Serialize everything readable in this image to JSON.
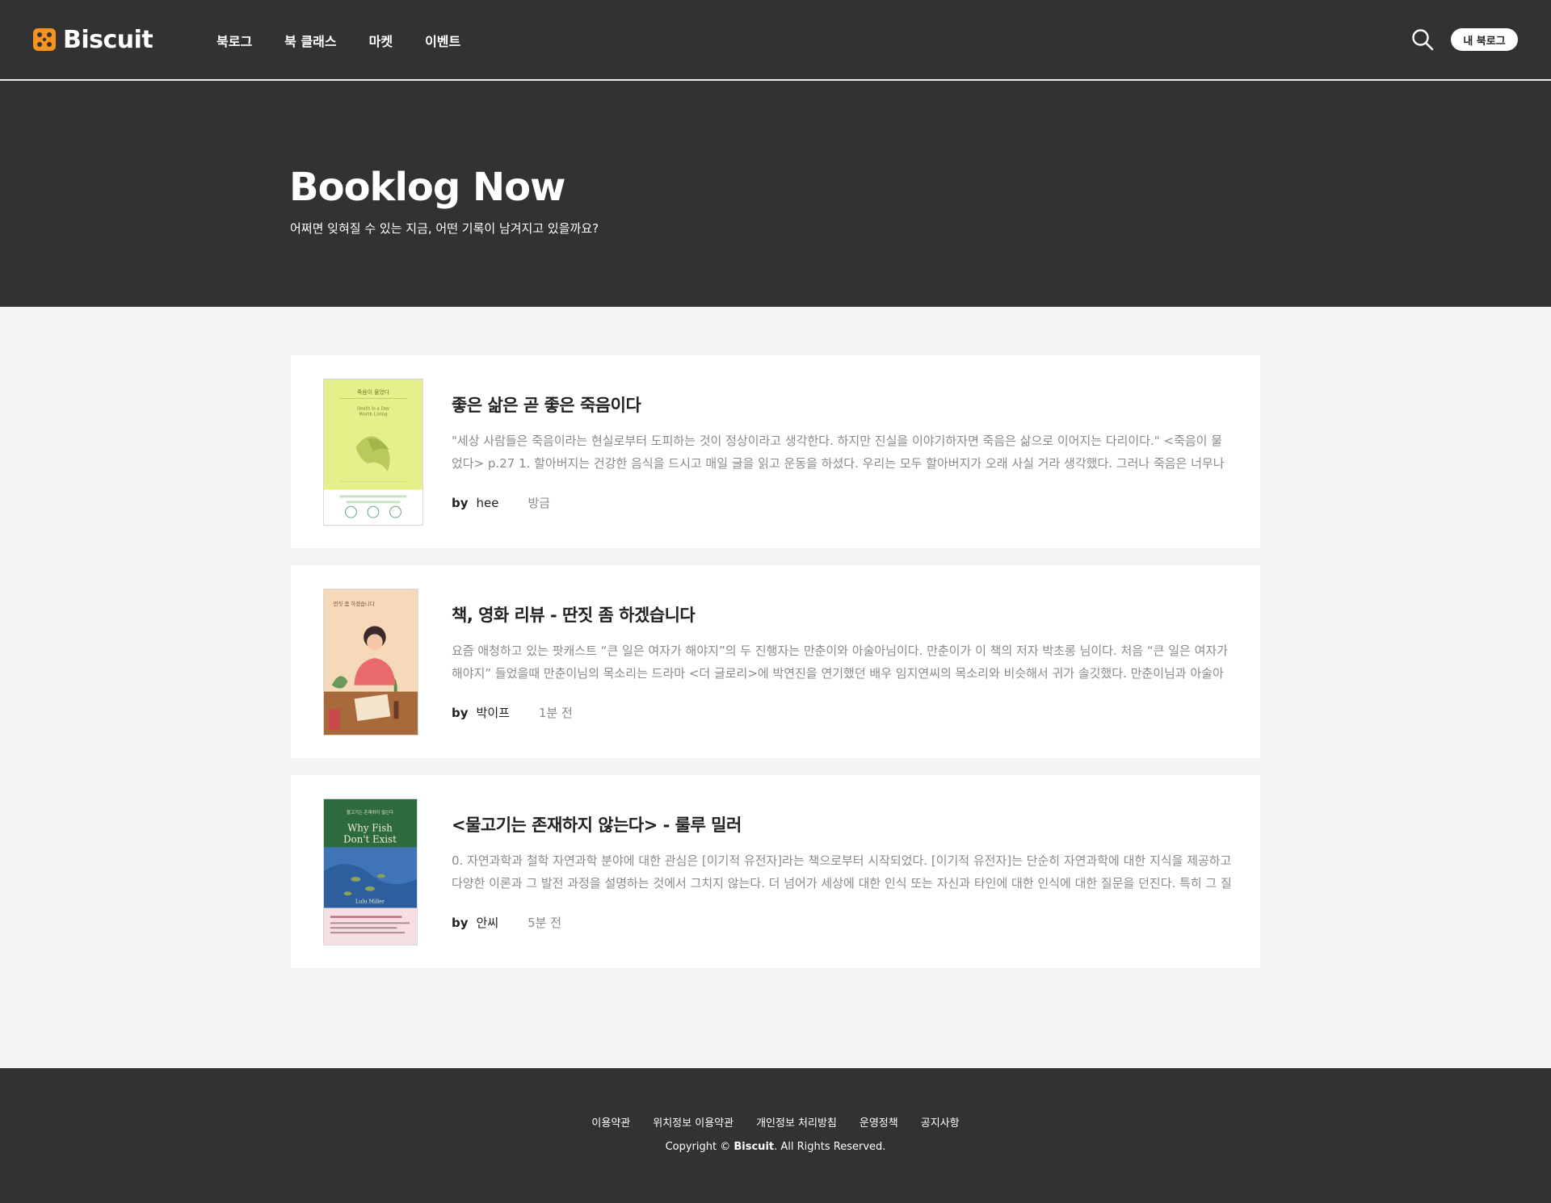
{
  "header": {
    "logo_text": "Biscuit",
    "nav": [
      "북로그",
      "북 클래스",
      "마켓",
      "이벤트"
    ],
    "my_booklog_label": "내 북로그",
    "search_icon": "search-icon"
  },
  "hero": {
    "title": "Booklog Now",
    "subtitle": "어쩌면 잊혀질 수 있는 지금, 어떤 기록이 남겨지고 있을까요?"
  },
  "posts": [
    {
      "title": "좋은 삶은 곧 좋은 죽음이다",
      "excerpt": "\"세상 사람들은 죽음이라는 현실로부터 도피하는 것이 정상이라고 생각한다. 하지만 진실을 이야기하자면 죽음은 삶으로 이어지는 다리이다.\" <죽음이 물었다> p.27 1. 할아버지는 건강한 음식을 드시고 매일 글을 읽고 운동을 하셨다. 우리는 모두 할아버지가 오래 사실 거라 생각했다. 그러나 죽음은 너무나 갑작스럽게 ...",
      "by": "by",
      "author": "hee",
      "time": "방금",
      "cover": {
        "title_ko": "죽음이 물었다",
        "title_en1": "Death Is a Day",
        "title_en2": "Worth Living"
      }
    },
    {
      "title": "책, 영화 리뷰 - 딴짓 좀 하겠습니다",
      "excerpt": "요즘 애청하고 있는 팟캐스트 “큰 일은 여자가 해야지”의 두 진행자는 만춘이와 아술아님이다. 만춘이가 이 책의 저자 박초롱 님이다. 처음 “큰 일은 여자가 해야지” 들었을때 만춘이님의 목소리는 드라마 <더 글로리>에 박연진을 연기했던 배우 임지연씨의 목소리와 비슷해서 귀가 솔깃했다. 만춘이님과 아술아님의 ...",
      "by": "by",
      "author": "박이프",
      "time": "1분 전",
      "cover": {
        "title_ko": "딴짓 좀 하겠습니다"
      }
    },
    {
      "title": "<물고기는 존재하지 않는다> - 룰루 밀러",
      "excerpt": "0. 자연과학과 철학 자연과학 분야에 대한 관심은 [이기적 유전자]라는 책으로부터 시작되었다. [이기적 유전자]는 단순히 자연과학에 대한 지식을 제공하고 다양한 이론과 그 발전 과정을 설명하는 것에서 그치지 않는다. 더 넘어가 세상에 대한 인식 또는 자신과 타인에 대한 인식에 대한 질문을 던진다. 특히 그 질문을 ...",
      "by": "by",
      "author": "안씨",
      "time": "5분 전",
      "cover": {
        "title_ko": "물고기는 존재하지 않는다",
        "title_en1": "Why Fish",
        "title_en2": "Don't Exist",
        "author_en": "Lulu Miller"
      }
    }
  ],
  "footer": {
    "links": [
      "이용약관",
      "위치정보 이용약관",
      "개인정보 처리방침",
      "운영정책",
      "공지사항"
    ],
    "copyright_prefix": "Copyright ©",
    "copyright_brand": "Biscuit",
    "copyright_suffix": ". All Rights Reserved."
  },
  "colors": {
    "header_bg": "#323232",
    "page_bg": "#f4f4f4",
    "logo_accent": "#f7931e",
    "muted_text": "#8a8a8a"
  }
}
